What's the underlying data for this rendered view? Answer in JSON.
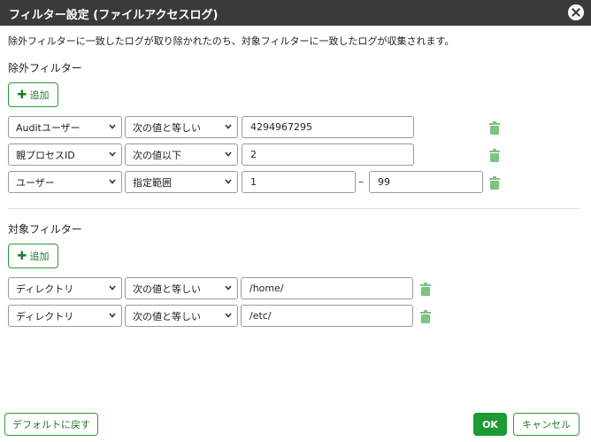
{
  "dialog": {
    "title": "フィルター設定 (ファイルアクセスログ)",
    "description": "除外フィルターに一致したログが取り除かれたのち、対象フィルターに一致したログが収集されます。"
  },
  "exclude": {
    "title": "除外フィルター",
    "add_label": "追加",
    "rows": [
      {
        "field": "Auditユーザー",
        "operator": "次の値と等しい",
        "value": "4294967295"
      },
      {
        "field": "親プロセスID",
        "operator": "次の値以下",
        "value": "2"
      },
      {
        "field": "ユーザー",
        "operator": "指定範囲",
        "value": "1",
        "separator": "–",
        "value2": "99"
      }
    ]
  },
  "include": {
    "title": "対象フィルター",
    "add_label": "追加",
    "rows": [
      {
        "field": "ディレクトリ",
        "operator": "次の値と等しい",
        "value": "/home/"
      },
      {
        "field": "ディレクトリ",
        "operator": "次の値と等しい",
        "value": "/etc/"
      }
    ]
  },
  "footer": {
    "reset_label": "デフォルトに戻す",
    "ok_label": "OK",
    "cancel_label": "キャンセル"
  },
  "colors": {
    "titlebar": "#3a3a3a",
    "accent": "#1e9a35",
    "trash_icon": "#7cc47f"
  },
  "icons": {
    "close": "close-icon",
    "add": "plus-icon",
    "delete": "trash-icon",
    "dropdown": "chevron-down-icon"
  }
}
